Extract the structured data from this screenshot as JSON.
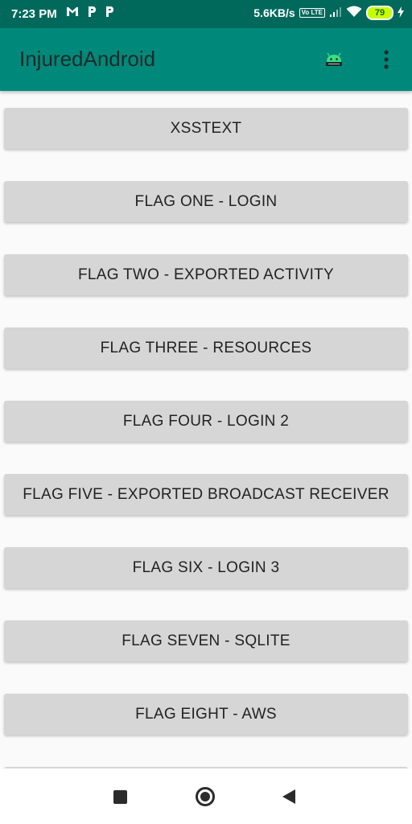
{
  "status_bar": {
    "time": "7:23 PM",
    "left_icons": [
      "gmail-icon",
      "paytm-icon",
      "paytm-icon"
    ],
    "network_speed": "5.6KB/s",
    "volte_label": "Vo LTE",
    "battery_level": "79"
  },
  "app_bar": {
    "title": "InjuredAndroid",
    "action_icon": "android-icon",
    "menu_icon": "more-vert-icon"
  },
  "buttons": [
    "XSSTEXT",
    "FLAG ONE - LOGIN",
    "FLAG TWO - EXPORTED ACTIVITY",
    "FLAG THREE - RESOURCES",
    "FLAG FOUR - LOGIN 2",
    "FLAG FIVE - EXPORTED BROADCAST RECEIVER",
    "FLAG SIX - LOGIN 3",
    "FLAG SEVEN - SQLITE",
    "FLAG EIGHT - AWS"
  ],
  "nav_bar": {
    "icons": [
      "recents-icon",
      "home-icon",
      "back-icon"
    ]
  },
  "colors": {
    "status_bar": "#00695c",
    "app_bar": "#00897b",
    "button_bg": "#d6d6d6",
    "background": "#fafafa"
  }
}
